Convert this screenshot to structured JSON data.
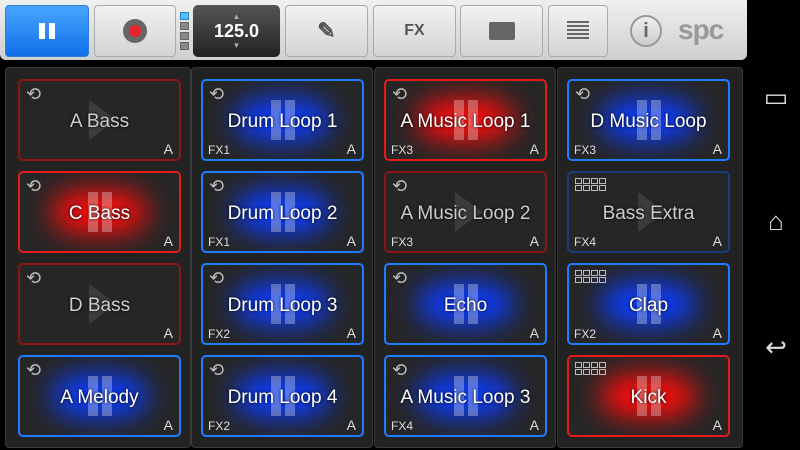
{
  "toolbar": {
    "bpm": "125.0",
    "fx_label": "FX",
    "logo": "spc",
    "info_label": "i"
  },
  "pads": [
    [
      {
        "name": "A Bass",
        "color": "red",
        "active": false,
        "icon": "loop",
        "fx": "",
        "slot": "A"
      },
      {
        "name": "C Bass",
        "color": "red",
        "active": true,
        "icon": "loop",
        "fx": "",
        "slot": "A"
      },
      {
        "name": "D Bass",
        "color": "red",
        "active": false,
        "icon": "loop",
        "fx": "",
        "slot": "A"
      },
      {
        "name": "A Melody",
        "color": "blue",
        "active": true,
        "icon": "loop",
        "fx": "",
        "slot": "A"
      }
    ],
    [
      {
        "name": "Drum Loop  1",
        "color": "blue",
        "active": true,
        "icon": "loop",
        "fx": "FX1",
        "slot": "A"
      },
      {
        "name": "Drum Loop  2",
        "color": "blue",
        "active": true,
        "icon": "loop",
        "fx": "FX1",
        "slot": "A"
      },
      {
        "name": "Drum Loop  3",
        "color": "blue",
        "active": true,
        "icon": "loop",
        "fx": "FX2",
        "slot": "A"
      },
      {
        "name": "Drum Loop  4",
        "color": "blue",
        "active": true,
        "icon": "loop",
        "fx": "FX2",
        "slot": "A"
      }
    ],
    [
      {
        "name": "A Music Loop 1",
        "color": "red",
        "active": true,
        "icon": "loop",
        "fx": "FX3",
        "slot": "A"
      },
      {
        "name": "A Music Loop 2",
        "color": "red",
        "active": false,
        "icon": "loop",
        "fx": "FX3",
        "slot": "A"
      },
      {
        "name": "Echo",
        "color": "blue",
        "active": true,
        "icon": "loop",
        "fx": "",
        "slot": "A"
      },
      {
        "name": "A Music Loop 3",
        "color": "blue",
        "active": true,
        "icon": "loop",
        "fx": "FX4",
        "slot": "A"
      }
    ],
    [
      {
        "name": "D Music Loop",
        "color": "blue",
        "active": true,
        "icon": "loop",
        "fx": "FX3",
        "slot": "A"
      },
      {
        "name": "Bass Extra",
        "color": "blue",
        "active": false,
        "icon": "grid",
        "fx": "FX4",
        "slot": "A"
      },
      {
        "name": "Clap",
        "color": "blue",
        "active": true,
        "icon": "grid",
        "fx": "FX2",
        "slot": "A"
      },
      {
        "name": "Kick",
        "color": "red",
        "active": true,
        "icon": "grid",
        "fx": "",
        "slot": "A"
      }
    ]
  ]
}
